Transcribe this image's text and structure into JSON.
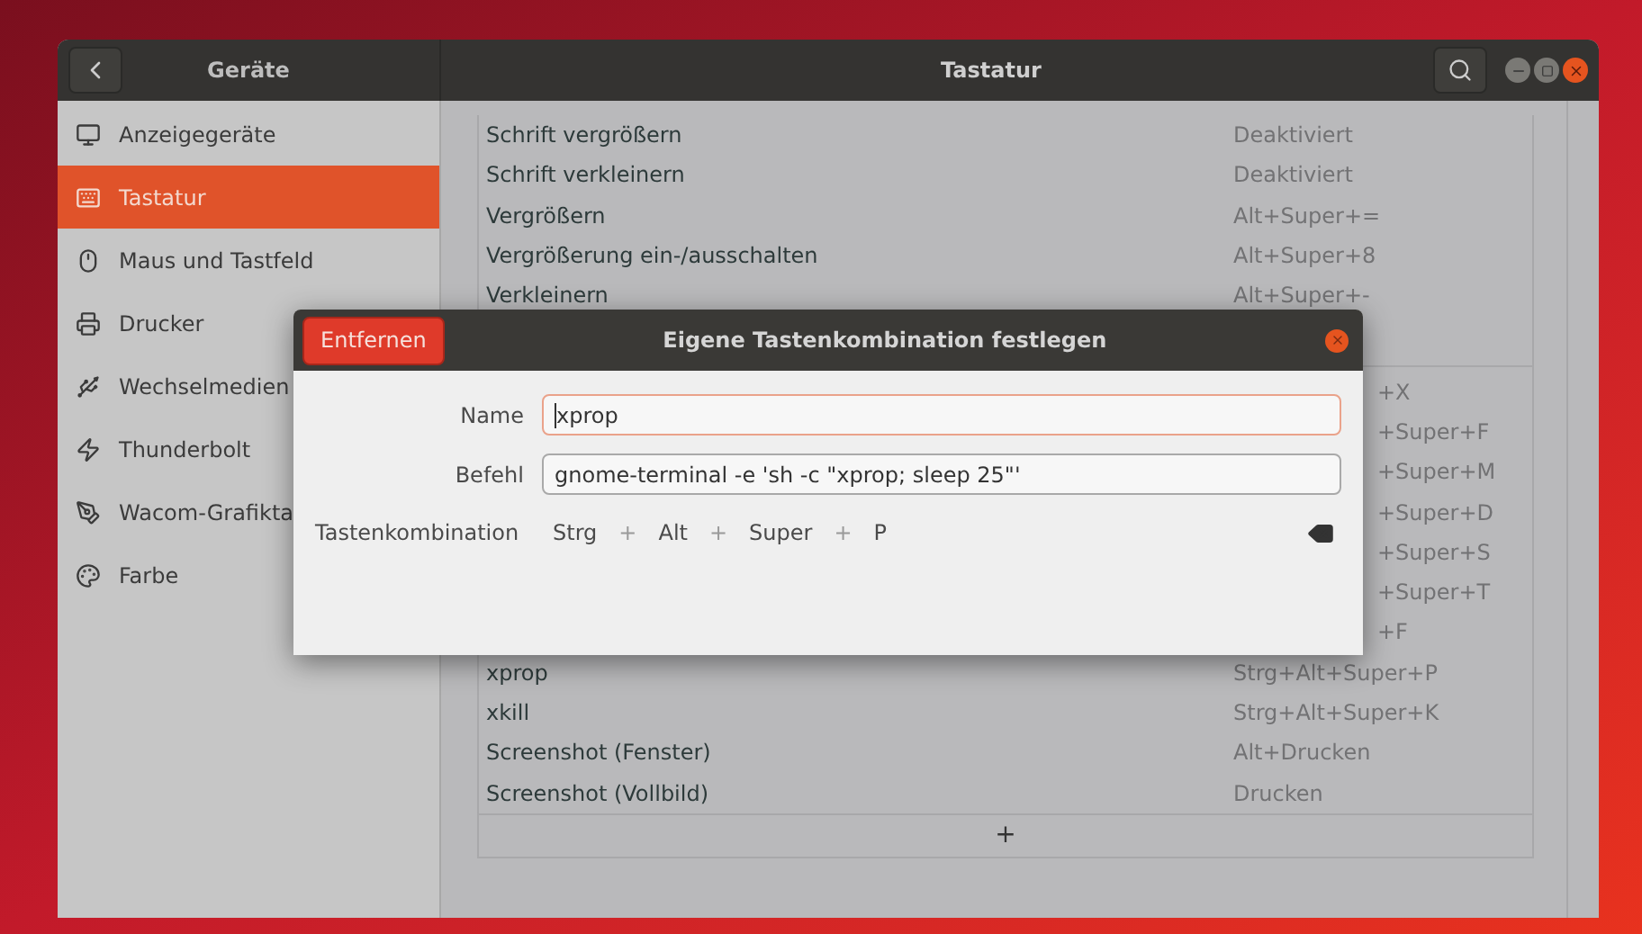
{
  "window": {
    "sidebar_title": "Geräte",
    "title": "Tastatur"
  },
  "sidebar": {
    "items": [
      {
        "label": "Anzeigegeräte",
        "selected": false
      },
      {
        "label": "Tastatur",
        "selected": true
      },
      {
        "label": "Maus und Tastfeld",
        "selected": false
      },
      {
        "label": "Drucker",
        "selected": false
      },
      {
        "label": "Wechselmedien",
        "selected": false
      },
      {
        "label": "Thunderbolt",
        "selected": false
      },
      {
        "label": "Wacom-Grafikta",
        "selected": false
      },
      {
        "label": "Farbe",
        "selected": false
      }
    ]
  },
  "shortcuts": {
    "sections": [
      {
        "rows": [
          {
            "kind": "full",
            "name": "Schrift vergrößern",
            "accel": "Deaktiviert"
          },
          {
            "kind": "full",
            "name": "Schrift verkleinern",
            "accel": "Deaktiviert"
          },
          {
            "kind": "full",
            "name": "Vergrößern",
            "accel": "Alt+Super+="
          },
          {
            "kind": "full",
            "name": "Vergrößerung ein-/ausschalten",
            "accel": "Alt+Super+8"
          },
          {
            "kind": "full",
            "name": "Verkleinern",
            "accel": "Alt+Super+-"
          }
        ]
      },
      {
        "rows": [
          {
            "kind": "covered",
            "accel": "+X"
          },
          {
            "kind": "covered",
            "accel": "+Super+F"
          },
          {
            "kind": "covered",
            "accel": "+Super+M"
          },
          {
            "kind": "covered",
            "accel": "+Super+D"
          },
          {
            "kind": "covered",
            "accel": "+Super+S"
          },
          {
            "kind": "covered",
            "accel": "+Super+T"
          },
          {
            "kind": "covered",
            "accel": "+F"
          },
          {
            "kind": "full",
            "name": "xprop",
            "accel": "Strg+Alt+Super+P"
          },
          {
            "kind": "full",
            "name": "xkill",
            "accel": "Strg+Alt+Super+K"
          },
          {
            "kind": "full",
            "name": "Screenshot (Fenster)",
            "accel": "Alt+Drucken"
          },
          {
            "kind": "full",
            "name": "Screenshot (Vollbild)",
            "accel": "Drucken"
          }
        ]
      }
    ],
    "add_button": "+"
  },
  "dialog": {
    "title": "Eigene Tastenkombination festlegen",
    "remove_button": "Entfernen",
    "fields": [
      {
        "label": "Name",
        "value": "xprop",
        "focused": true
      },
      {
        "label": "Befehl",
        "value": "gnome-terminal -e 'sh -c \"xprop; sleep 25\"'",
        "focused": false
      }
    ],
    "shortcut_label": "Tastenkombination",
    "shortcut": [
      {
        "kind": "key",
        "text": "Strg"
      },
      {
        "kind": "sep",
        "text": "+"
      },
      {
        "kind": "key",
        "text": "Alt"
      },
      {
        "kind": "sep",
        "text": "+"
      },
      {
        "kind": "key",
        "text": "Super"
      },
      {
        "kind": "sep",
        "text": "+"
      },
      {
        "kind": "key",
        "text": "P"
      }
    ]
  }
}
